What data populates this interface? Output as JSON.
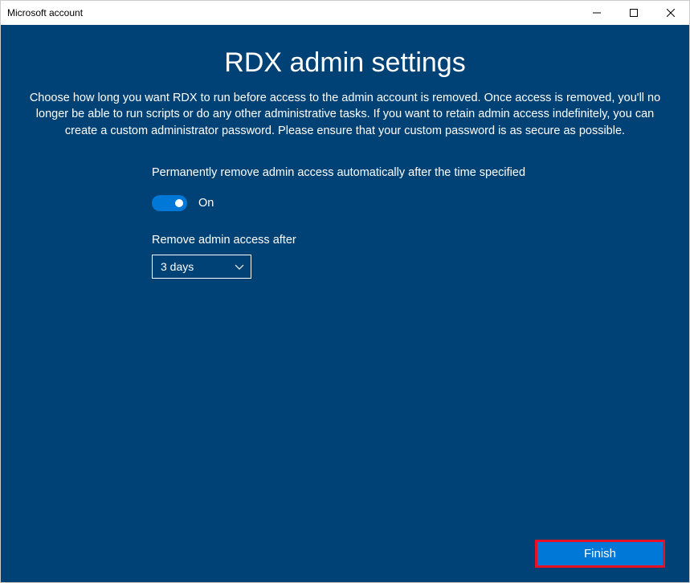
{
  "window": {
    "title": "Microsoft account"
  },
  "page": {
    "title": "RDX admin settings",
    "description": "Choose how long you want RDX to run before access to the admin account is removed. Once access is removed, you'll no longer be able to run scripts or do any other administrative tasks. If you want to retain admin access indefinitely, you can create a custom administrator password. Please ensure that your custom password is as secure as possible."
  },
  "settings": {
    "toggle_label": "Permanently remove admin access automatically after the time specified",
    "toggle_state": "On",
    "dropdown_label": "Remove admin access after",
    "dropdown_value": "3 days"
  },
  "footer": {
    "finish_label": "Finish"
  }
}
